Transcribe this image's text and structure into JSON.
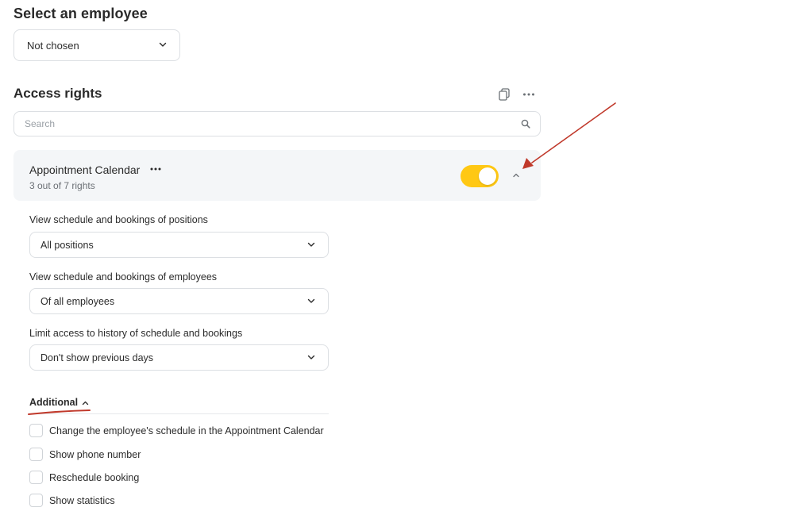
{
  "employee_section": {
    "title": "Select an employee",
    "select_value": "Not chosen"
  },
  "access_rights": {
    "title": "Access rights",
    "search_placeholder": "Search",
    "module": {
      "title": "Appointment Calendar",
      "subtitle": "3 out of 7 rights",
      "enabled": true
    },
    "fields": [
      {
        "label": "View schedule and bookings of positions",
        "value": "All positions"
      },
      {
        "label": "View schedule and bookings of employees",
        "value": "Of all employees"
      },
      {
        "label": "Limit access to history of schedule and bookings",
        "value": "Don't show previous days"
      }
    ],
    "additional": {
      "title": "Additional",
      "items": [
        {
          "label": "Change the employee's schedule in the Appointment Calendar",
          "checked": false
        },
        {
          "label": "Show phone number",
          "checked": false
        },
        {
          "label": "Reschedule booking",
          "checked": false
        },
        {
          "label": "Show statistics",
          "checked": false
        }
      ]
    }
  },
  "colors": {
    "toggle_on": "#ffc814",
    "annotation": "#c0392b",
    "card_bg": "#f4f6f8"
  }
}
